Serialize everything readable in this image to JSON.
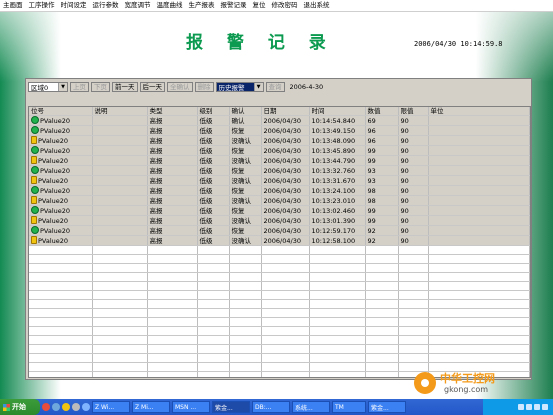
{
  "menu": [
    "主画面",
    "工序操作",
    "时间设定",
    "运行参数",
    "宽度调节",
    "温度曲线",
    "生产报表",
    "报警记录",
    "复位",
    "修改密码",
    "退出系统"
  ],
  "title": "报 警 记 录",
  "datetime": "2006/04/30  10:14:59.8",
  "toolbar": {
    "area_value": "区域0",
    "prev_page": "上页",
    "next_page": "下页",
    "prev_day": "前一天",
    "next_day": "后一天",
    "all_confirm": "全确认",
    "delete": "删除",
    "history_value": "历史报警",
    "query": "查询",
    "date": "2006-4-30"
  },
  "table": {
    "headers": [
      "位号",
      "说明",
      "类型",
      "级别",
      "确认",
      "日期",
      "时间",
      "数值",
      "限值",
      "单位"
    ],
    "rows": [
      {
        "icon": "green",
        "tag": "PValue20",
        "desc": "",
        "type": "高报",
        "level": "低级",
        "ack": "确认",
        "date": "2006/04/30",
        "time": "10:14:54.840",
        "value": "69",
        "limit": "90",
        "unit": ""
      },
      {
        "icon": "green",
        "tag": "PValue20",
        "desc": "",
        "type": "高报",
        "level": "低级",
        "ack": "恢复",
        "date": "2006/04/30",
        "time": "10:13:49.150",
        "value": "96",
        "limit": "90",
        "unit": ""
      },
      {
        "icon": "yellow",
        "tag": "PValue20",
        "desc": "",
        "type": "高报",
        "level": "低级",
        "ack": "没确认",
        "date": "2006/04/30",
        "time": "10:13:48.090",
        "value": "96",
        "limit": "90",
        "unit": ""
      },
      {
        "icon": "green",
        "tag": "PValue20",
        "desc": "",
        "type": "高报",
        "level": "低级",
        "ack": "恢复",
        "date": "2006/04/30",
        "time": "10:13:45.890",
        "value": "99",
        "limit": "90",
        "unit": ""
      },
      {
        "icon": "yellow",
        "tag": "PValue20",
        "desc": "",
        "type": "高报",
        "level": "低级",
        "ack": "没确认",
        "date": "2006/04/30",
        "time": "10:13:44.790",
        "value": "99",
        "limit": "90",
        "unit": ""
      },
      {
        "icon": "green",
        "tag": "PValue20",
        "desc": "",
        "type": "高报",
        "level": "低级",
        "ack": "恢复",
        "date": "2006/04/30",
        "time": "10:13:32.760",
        "value": "93",
        "limit": "90",
        "unit": ""
      },
      {
        "icon": "yellow",
        "tag": "PValue20",
        "desc": "",
        "type": "高报",
        "level": "低级",
        "ack": "没确认",
        "date": "2006/04/30",
        "time": "10:13:31.670",
        "value": "93",
        "limit": "90",
        "unit": ""
      },
      {
        "icon": "green",
        "tag": "PValue20",
        "desc": "",
        "type": "高报",
        "level": "低级",
        "ack": "恢复",
        "date": "2006/04/30",
        "time": "10:13:24.100",
        "value": "98",
        "limit": "90",
        "unit": ""
      },
      {
        "icon": "yellow",
        "tag": "PValue20",
        "desc": "",
        "type": "高报",
        "level": "低级",
        "ack": "没确认",
        "date": "2006/04/30",
        "time": "10:13:23.010",
        "value": "98",
        "limit": "90",
        "unit": ""
      },
      {
        "icon": "green",
        "tag": "PValue20",
        "desc": "",
        "type": "高报",
        "level": "低级",
        "ack": "恢复",
        "date": "2006/04/30",
        "time": "10:13:02.460",
        "value": "99",
        "limit": "90",
        "unit": ""
      },
      {
        "icon": "yellow",
        "tag": "PValue20",
        "desc": "",
        "type": "高报",
        "level": "低级",
        "ack": "没确认",
        "date": "2006/04/30",
        "time": "10:13:01.390",
        "value": "99",
        "limit": "90",
        "unit": ""
      },
      {
        "icon": "green",
        "tag": "PValue20",
        "desc": "",
        "type": "高报",
        "level": "低级",
        "ack": "恢复",
        "date": "2006/04/30",
        "time": "10:12:59.170",
        "value": "92",
        "limit": "90",
        "unit": ""
      },
      {
        "icon": "yellow",
        "tag": "PValue20",
        "desc": "",
        "type": "高报",
        "level": "低级",
        "ack": "没确认",
        "date": "2006/04/30",
        "time": "10:12:58.100",
        "value": "92",
        "limit": "90",
        "unit": ""
      }
    ]
  },
  "watermark": {
    "cn": "中华工控网",
    "en": "gkong.com"
  },
  "taskbar": {
    "start": "开始",
    "tasks": [
      "Z Wi...",
      "Z Mi...",
      "MSN ...",
      "紫金...",
      "DB:...",
      "系统...",
      "TM",
      "紫金..."
    ],
    "clock": ""
  }
}
